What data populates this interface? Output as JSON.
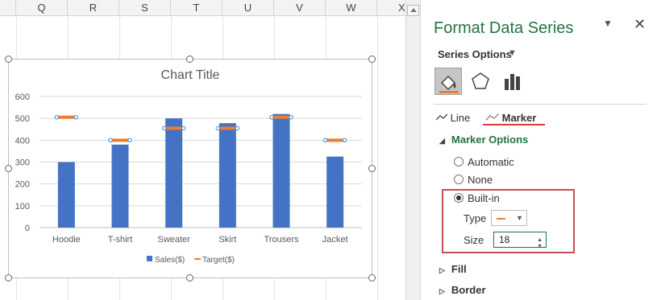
{
  "sheet": {
    "columns": [
      "Q",
      "R",
      "S",
      "T",
      "U",
      "V",
      "W",
      "X"
    ]
  },
  "chart_data": {
    "type": "bar",
    "title": "Chart Title",
    "categories": [
      "Hoodie",
      "T-shirt",
      "Sweater",
      "Skirt",
      "Trousers",
      "Jacket"
    ],
    "series": [
      {
        "name": "Sales($)",
        "type": "bar",
        "values": [
          300,
          380,
          500,
          478,
          520,
          325
        ],
        "color": "#4472c4"
      },
      {
        "name": "Target($)",
        "type": "marker",
        "values": [
          505,
          400,
          455,
          455,
          505,
          400
        ],
        "color": "#ed7d31"
      }
    ],
    "ylim": [
      0,
      600
    ],
    "yticks": [
      0,
      100,
      200,
      300,
      400,
      500,
      600
    ],
    "grid": true,
    "legend": "bottom"
  },
  "pane": {
    "title": "Format Data Series",
    "dropdown_icon": "chevron-down-icon",
    "close_icon": "close-icon",
    "series_options": "Series Options",
    "tabs": {
      "line": "Line",
      "marker": "Marker"
    },
    "marker_options": {
      "header": "Marker Options",
      "automatic": "Automatic",
      "none": "None",
      "builtin": "Built-in",
      "type_label": "Type",
      "size_label": "Size",
      "size_value": "18"
    },
    "fill": "Fill",
    "border": "Border",
    "accent_color": "#217346"
  }
}
